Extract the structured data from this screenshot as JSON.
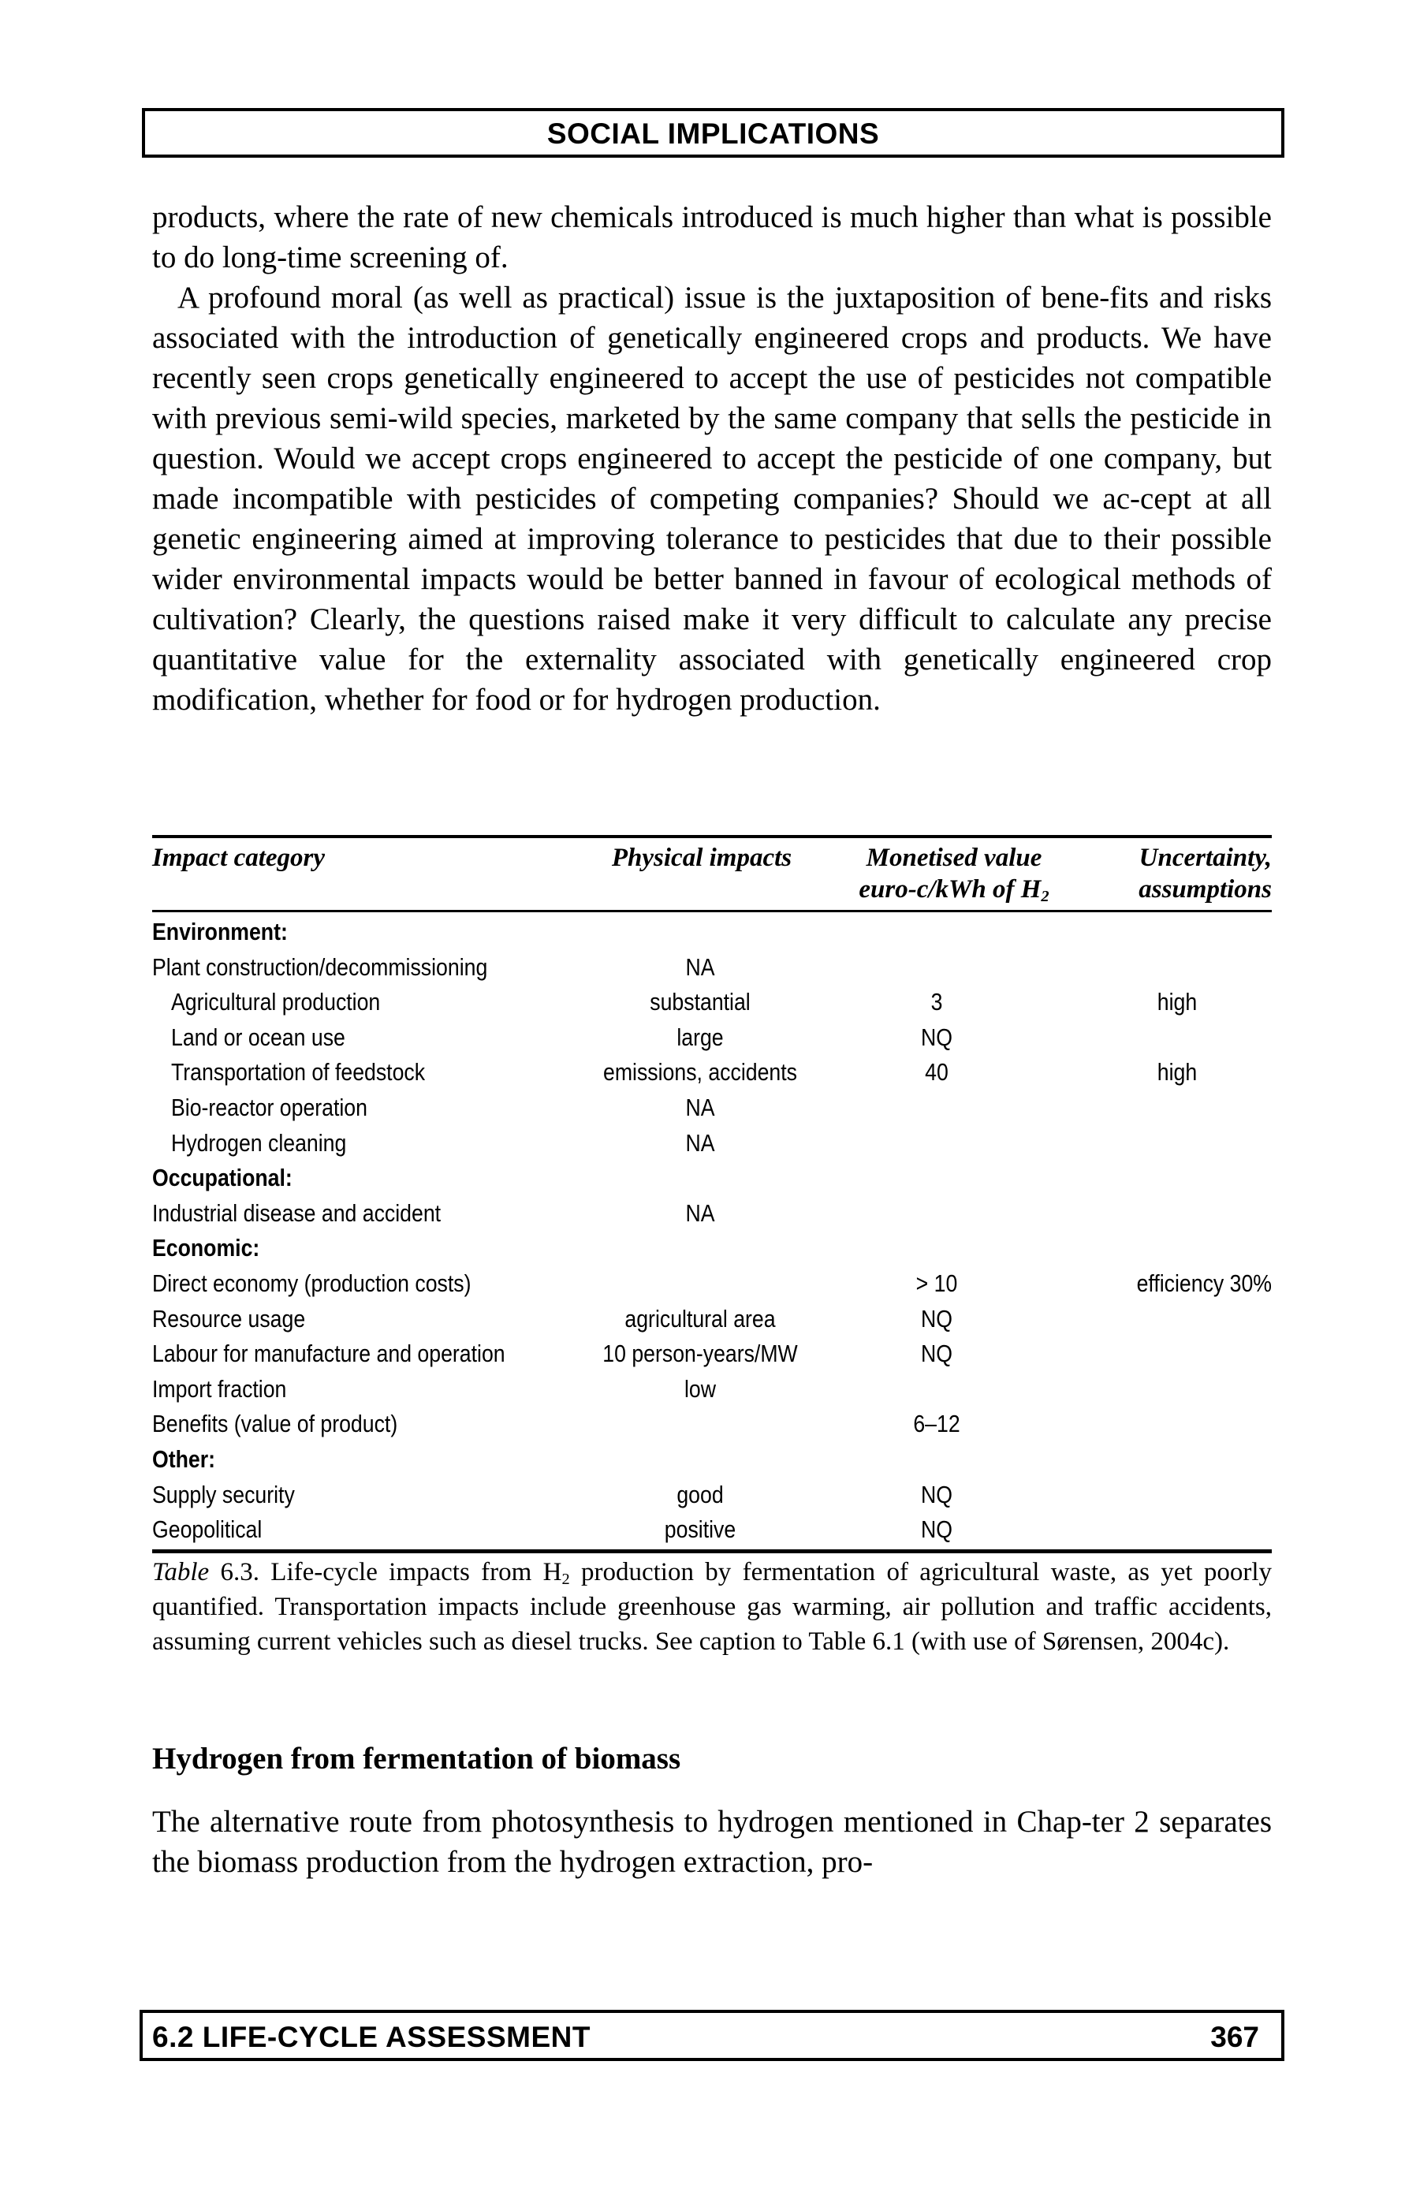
{
  "header": {
    "running_title": "SOCIAL IMPLICATIONS"
  },
  "body_top": {
    "paragraphs": [
      "products, where the rate of new chemicals introduced is much higher than what is possible to do long-time screening of.",
      "A profound moral (as well as practical) issue is the juxtaposition of bene-fits and risks associated with the introduction of genetically engineered crops and products. We have recently seen crops genetically engineered to accept the use of pesticides not compatible with previous semi-wild species, marketed by the same company that sells the pesticide in question. Would we accept crops engineered to accept the pesticide of one company, but made incompatible with pesticides of competing companies? Should we ac-cept at all genetic engineering aimed at improving tolerance to pesticides that due to their possible wider environmental impacts would be better banned in favour of ecological methods of cultivation? Clearly, the questions raised make it very difficult to calculate any precise quantitative value for the externality associated with genetically engineered crop modification, whether for food or for hydrogen production."
    ]
  },
  "table": {
    "headers": {
      "impact_category": "Impact category",
      "physical_impacts": "Physical impacts",
      "monetised_line1": "Monetised value",
      "monetised_line2_prefix": "euro-c/kWh of H",
      "monetised_line2_sub": "2",
      "uncertainty_line1": "Uncertainty,",
      "uncertainty_line2": "assumptions"
    },
    "rows": [
      {
        "type": "group",
        "category": "Environment:",
        "physical": "",
        "monetised": "",
        "uncertainty": ""
      },
      {
        "type": "item",
        "category": "Plant construction/decommissioning",
        "physical": "NA",
        "monetised": "",
        "uncertainty": ""
      },
      {
        "type": "sub",
        "category": "Agricultural production",
        "physical": "substantial",
        "monetised": "3",
        "uncertainty": "high"
      },
      {
        "type": "sub",
        "category": "Land or ocean use",
        "physical": "large",
        "monetised": "NQ",
        "uncertainty": ""
      },
      {
        "type": "sub",
        "category": "Transportation of feedstock",
        "physical": "emissions, accidents",
        "monetised": "40",
        "uncertainty": "high"
      },
      {
        "type": "sub",
        "category": "Bio-reactor operation",
        "physical": "NA",
        "monetised": "",
        "uncertainty": ""
      },
      {
        "type": "sub",
        "category": "Hydrogen cleaning",
        "physical": "NA",
        "monetised": "",
        "uncertainty": ""
      },
      {
        "type": "group",
        "category": "Occupational:",
        "physical": "",
        "monetised": "",
        "uncertainty": ""
      },
      {
        "type": "item",
        "category": "Industrial disease and accident",
        "physical": "NA",
        "monetised": "",
        "uncertainty": ""
      },
      {
        "type": "group",
        "category": "Economic:",
        "physical": "",
        "monetised": "",
        "uncertainty": ""
      },
      {
        "type": "item",
        "category": "Direct economy (production costs)",
        "physical": "",
        "monetised": "> 10",
        "uncertainty": "efficiency 30%"
      },
      {
        "type": "item",
        "category": "Resource usage",
        "physical": "agricultural area",
        "monetised": "NQ",
        "uncertainty": ""
      },
      {
        "type": "item",
        "category": "Labour for manufacture and operation",
        "physical": "10 person-years/MW",
        "monetised": "NQ",
        "uncertainty": ""
      },
      {
        "type": "item",
        "category": "Import fraction",
        "physical": "low",
        "monetised": "",
        "uncertainty": ""
      },
      {
        "type": "item",
        "category": "Benefits (value of product)",
        "physical": "",
        "monetised": "6–12",
        "uncertainty": ""
      },
      {
        "type": "group",
        "category": "Other:",
        "physical": "",
        "monetised": "",
        "uncertainty": ""
      },
      {
        "type": "item",
        "category": "Supply security",
        "physical": "good",
        "monetised": "NQ",
        "uncertainty": ""
      },
      {
        "type": "item",
        "category": "Geopolitical",
        "physical": "positive",
        "monetised": "NQ",
        "uncertainty": ""
      }
    ],
    "caption": {
      "label": "Table",
      "number": " 6.3.",
      "text_before_sub": " Life-cycle impacts from H",
      "sub": "2",
      "text_after_sub": " production by fermentation of agricultural waste, as yet poorly quantified. Transportation impacts include greenhouse gas warming, air pollution and traffic accidents, assuming current vehicles such as diesel trucks. See caption to Table 6.1 (with use of Sørensen, 2004c)."
    }
  },
  "section": {
    "heading": "Hydrogen from fermentation of biomass",
    "paragraph": "The alternative route from photosynthesis to hydrogen mentioned in Chap-ter 2 separates the biomass production from the hydrogen extraction, pro-"
  },
  "footer": {
    "section_title": "6.2 LIFE-CYCLE ASSESSMENT",
    "page_number": "367"
  }
}
